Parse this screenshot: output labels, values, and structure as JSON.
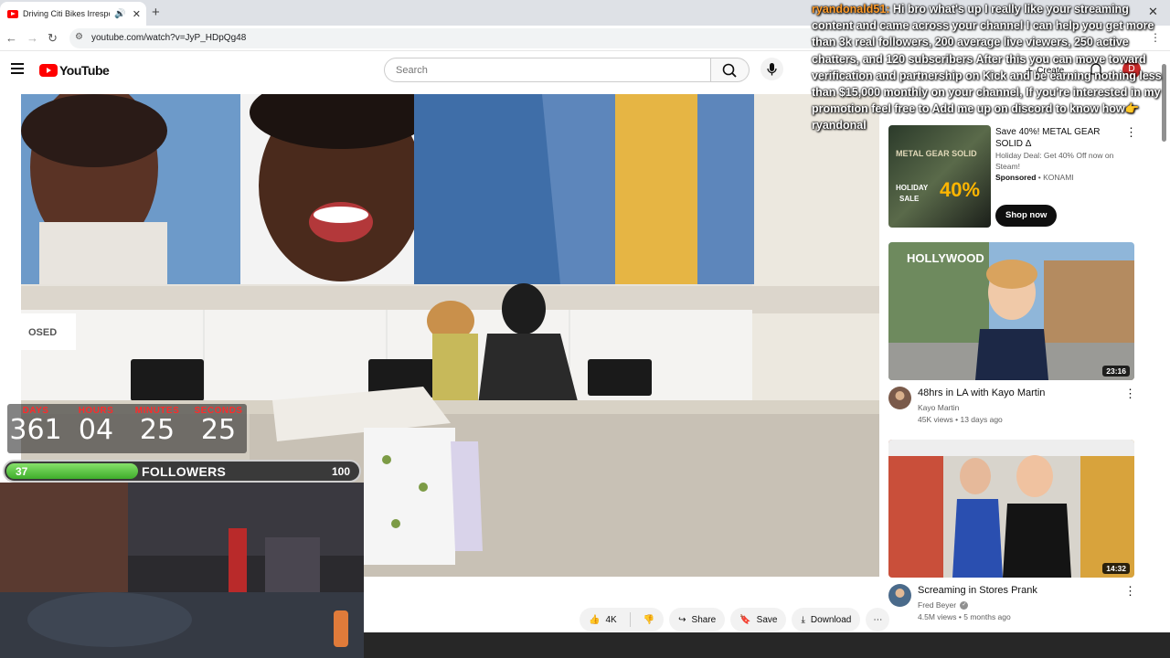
{
  "browser": {
    "tab_title": "Driving Citi Bikes Irresponsi",
    "url": "youtube.com/watch?v=JyP_HDpQg48"
  },
  "youtube": {
    "logo_text": "YouTube",
    "search_placeholder": "Search",
    "create_label": "Create",
    "avatar_letter": "D"
  },
  "countdown": {
    "labels": [
      "DAYS",
      "HOURS",
      "MINUTES",
      "SECONDS"
    ],
    "values": [
      "361",
      "04",
      "25",
      "25"
    ]
  },
  "followers": {
    "label": "FOLLOWERS",
    "current": "37",
    "goal": "100",
    "progress_fraction": 0.37
  },
  "actions": {
    "like_count": "4K",
    "share": "Share",
    "save": "Save",
    "download": "Download"
  },
  "chat": {
    "username": "ryandonald51:",
    "message": "Hi bro what's up I really like your streaming content and came across your channel I can help you get more than 3k real followers, 200 average live viewers, 250 active chatters, and 120 subscribers After this you can move toward verification and partnership on Kick and be earning nothing less than $15,000 monthly on your channel, If you're interested in my promotion feel free to Add me up on discord to know how👉 ryandonal"
  },
  "sidebar": {
    "ad": {
      "title": "Save 40%! METAL GEAR SOLID Δ",
      "description": "Holiday Deal: Get 40% Off now on Steam!",
      "sponsored": "Sponsored",
      "advertiser": "KONAMI",
      "cta": "Shop now",
      "thumb_line1": "METAL GEAR SOLID",
      "thumb_line2": "HOLIDAY",
      "thumb_line3": "SALE",
      "thumb_percent": "40%"
    },
    "videos": [
      {
        "title": "48hrs in LA with Kayo Martin",
        "channel": "Kayo Martin",
        "views": "45K views",
        "age": "13 days ago",
        "duration": "23:16",
        "thumb_text": "HOLLYWOOD",
        "verified": false
      },
      {
        "title": "Screaming in Stores Prank",
        "channel": "Fred Beyer",
        "views": "4.5M views",
        "age": "5 months ago",
        "duration": "14:32",
        "verified": true
      }
    ]
  },
  "video_scene": {
    "sign_text": "OSED"
  },
  "colors": {
    "youtube_red": "#ff0000",
    "countdown_label": "#ff2a2a",
    "follower_fill": "#3fae2b",
    "chat_username": "#ff9c2b"
  }
}
